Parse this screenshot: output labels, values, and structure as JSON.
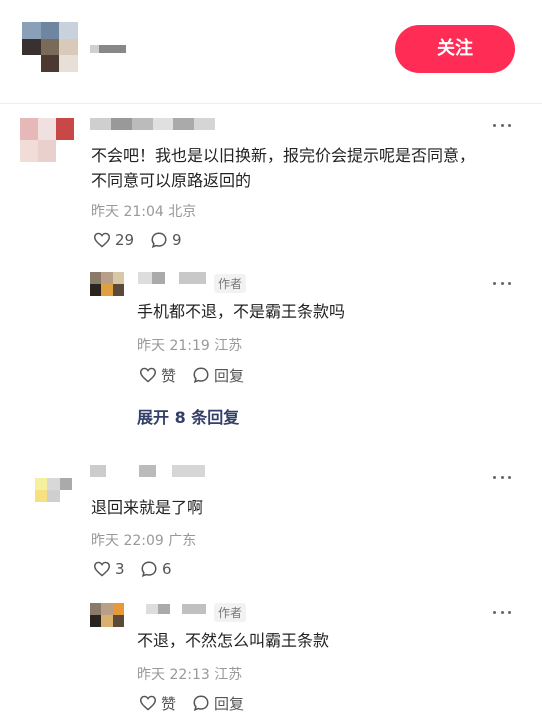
{
  "header": {
    "follow_label": "关注"
  },
  "comments": [
    {
      "text_line1": "不会吧！我也是以旧换新，报完价会提示呢是否同意，",
      "text_line2": "不同意可以原路返回的",
      "time": "昨天 21:04",
      "location": "北京",
      "likes": "29",
      "replies_count": "9",
      "reply": {
        "badge": "作者",
        "text": "手机都不退，不是霸王条款吗",
        "time": "昨天 21:19",
        "location": "江苏",
        "like_label": "赞",
        "reply_label": "回复"
      },
      "expand_label": "展开 8 条回复"
    },
    {
      "text_line1": "退回来就是了啊",
      "time": "昨天 22:09",
      "location": "广东",
      "likes": "3",
      "replies_count": "6",
      "reply": {
        "badge": "作者",
        "text": "不退，不然怎么叫霸王条款",
        "time": "昨天 22:13",
        "location": "江苏",
        "like_label": "赞",
        "reply_label": "回复"
      }
    }
  ],
  "colors": {
    "accent": "#ff2d55",
    "expand_text": "#333f66",
    "meta_text": "#999999"
  },
  "icons": [
    "more-icon",
    "heart-icon",
    "comment-icon"
  ]
}
